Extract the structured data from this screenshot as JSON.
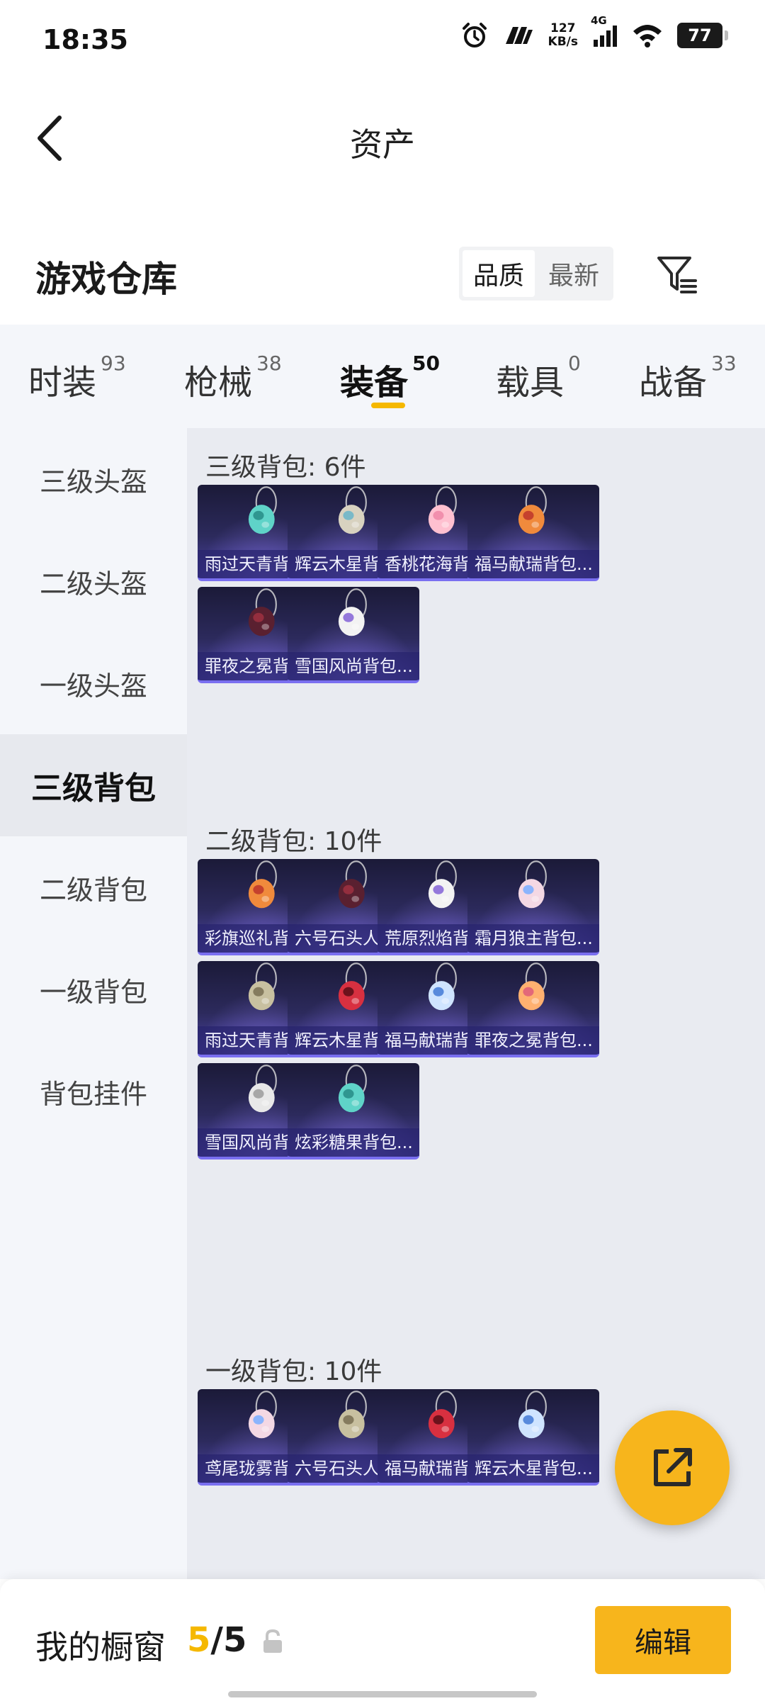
{
  "status_bar": {
    "time": "18:35",
    "net_speed_value": "127",
    "net_speed_unit": "KB/s",
    "network_type": "4G",
    "battery": "77",
    "icons": [
      "alarm-icon",
      "app-notification-icon",
      "signal-icon",
      "wifi-icon",
      "battery-icon"
    ]
  },
  "header": {
    "title": "资产",
    "back_icon": "chevron-left-icon"
  },
  "warehouse": {
    "title": "游戏仓库",
    "sort_options": [
      "品质",
      "最新"
    ],
    "sort_selected": "品质",
    "filter_icon": "filter-icon"
  },
  "tabs": [
    {
      "label": "时装",
      "count": "93"
    },
    {
      "label": "枪械",
      "count": "38"
    },
    {
      "label": "装备",
      "count": "50",
      "active": true
    },
    {
      "label": "载具",
      "count": "0"
    },
    {
      "label": "战备",
      "count": "33"
    }
  ],
  "sidebar": {
    "items": [
      "三级头盔",
      "二级头盔",
      "一级头盔",
      "三级背包",
      "二级背包",
      "一级背包",
      "背包挂件"
    ],
    "active": "三级背包"
  },
  "sections": [
    {
      "title": "三级背包: 6件",
      "items": [
        "雨过天青背包...",
        "辉云木星背包...",
        "香桃花海背包...",
        "福马献瑞背包...",
        "罪夜之冕背包...",
        "雪国风尚背包..."
      ]
    },
    {
      "title": "二级背包: 10件",
      "items": [
        "彩旗巡礼背包...",
        "六号石头人背...",
        "荒原烈焰背包...",
        "霜月狼主背包...",
        "雨过天青背包...",
        "辉云木星背包...",
        "福马献瑞背包...",
        "罪夜之冕背包...",
        "雪国风尚背包...",
        "炫彩糖果背包..."
      ]
    },
    {
      "title": "一级背包: 10件",
      "items": [
        "鸢尾珑雾背包...",
        "六号石头人背...",
        "福马献瑞背包...",
        "辉云木星背包..."
      ]
    }
  ],
  "share_button_icon": "share-external-icon",
  "bottom_bar": {
    "label": "我的橱窗",
    "current": "5",
    "separator": "/",
    "total": "5",
    "lock_icon": "lock-icon",
    "edit_label": "编辑"
  },
  "colors": {
    "accent": "#f7b51c",
    "card_top": "#1b1a38",
    "card_bottom": "#4b43a3"
  }
}
